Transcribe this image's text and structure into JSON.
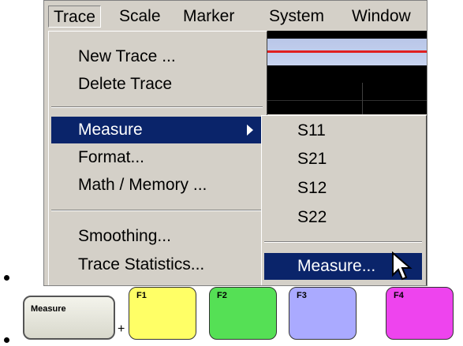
{
  "menubar": {
    "items": [
      "Trace",
      "Scale",
      "Marker",
      "System",
      "Window"
    ]
  },
  "trace_menu": {
    "items": [
      {
        "label": "New Trace ..."
      },
      {
        "label": "Delete Trace"
      },
      {
        "label": "Measure",
        "submenu": true,
        "highlighted": true
      },
      {
        "label": "Format..."
      },
      {
        "label": "Math / Memory ..."
      },
      {
        "label": "Smoothing..."
      },
      {
        "label": "Trace Statistics..."
      }
    ]
  },
  "measure_submenu": {
    "items": [
      "S11",
      "S21",
      "S12",
      "S22",
      "Measure..."
    ]
  },
  "keys": {
    "measure": "Measure",
    "plus": "+",
    "f1": "F1",
    "f2": "F2",
    "f3": "F3",
    "f4": "F4"
  },
  "colors": {
    "menu_bg": "#d4d0c8",
    "highlight": "#0a246a",
    "f1": "#ffff66",
    "f2": "#55e055",
    "f3": "#aaaaff",
    "f4": "#ee44ee"
  }
}
